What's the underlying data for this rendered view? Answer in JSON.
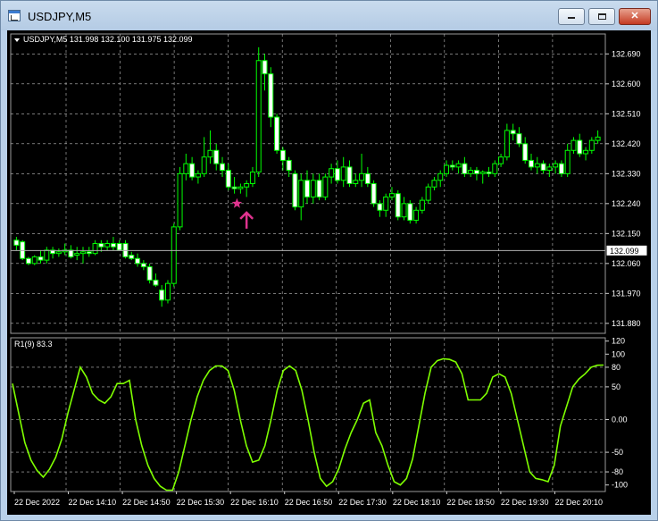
{
  "window": {
    "title": "USDJPY,M5",
    "minimize_icon": "minimize-icon",
    "maximize_icon": "maximize-icon",
    "close_icon": "close-icon",
    "close_label": "✕"
  },
  "price_panel": {
    "header": "USDJPY,M5  131.998 132.100 131.975 132.099",
    "collapse_icon": "triangle-down-icon",
    "current_price": "132.099",
    "annotation_icons": [
      "star-icon",
      "arrow-up-icon"
    ],
    "annotation_color": "#e0338f",
    "candle_color": "#00ff00",
    "grid_color": "#c0c0c0"
  },
  "oscillator_panel": {
    "header": "R1(9) 83.3",
    "line_color": "#7fff00"
  },
  "chart_data": [
    {
      "type": "candlestick",
      "title": "USDJPY,M5",
      "ylim": [
        131.85,
        132.75
      ],
      "y_ticks": [
        "132.690",
        "132.600",
        "132.510",
        "132.420",
        "132.330",
        "132.240",
        "132.150",
        "132.060",
        "131.970",
        "131.880"
      ],
      "x_ticks": [
        "22 Dec 2022",
        "22 Dec 14:10",
        "22 Dec 14:50",
        "22 Dec 15:30",
        "22 Dec 16:10",
        "22 Dec 16:50",
        "22 Dec 17:30",
        "22 Dec 18:10",
        "22 Dec 18:50",
        "22 Dec 19:30",
        "22 Dec 20:10"
      ],
      "last_price": 132.099,
      "ohlc": [
        [
          132.13,
          132.14,
          132.1,
          132.115
        ],
        [
          132.125,
          132.13,
          132.07,
          132.075
        ],
        [
          132.075,
          132.08,
          132.055,
          132.06
        ],
        [
          132.06,
          132.085,
          132.055,
          132.08
        ],
        [
          132.08,
          132.1,
          132.06,
          132.07
        ],
        [
          132.07,
          132.11,
          132.06,
          132.1
        ],
        [
          132.1,
          132.11,
          132.075,
          132.09
        ],
        [
          132.09,
          132.105,
          132.08,
          132.095
        ],
        [
          132.095,
          132.12,
          132.085,
          132.1
        ],
        [
          132.1,
          132.115,
          132.075,
          132.08
        ],
        [
          132.085,
          132.11,
          132.07,
          132.09
        ],
        [
          132.09,
          132.11,
          132.06,
          132.095
        ],
        [
          132.095,
          132.11,
          132.08,
          132.09
        ],
        [
          132.09,
          132.13,
          132.085,
          132.12
        ],
        [
          132.12,
          132.13,
          132.095,
          132.11
        ],
        [
          132.11,
          132.13,
          132.1,
          132.12
        ],
        [
          132.12,
          132.14,
          132.1,
          132.11
        ],
        [
          132.12,
          132.13,
          132.1,
          132.1
        ],
        [
          132.12,
          132.13,
          132.075,
          132.08
        ],
        [
          132.085,
          132.095,
          132.07,
          132.075
        ],
        [
          132.075,
          132.09,
          132.05,
          132.06
        ],
        [
          132.06,
          132.07,
          132.04,
          132.05
        ],
        [
          132.05,
          132.06,
          132.0,
          132.01
        ],
        [
          132.01,
          132.03,
          131.99,
          131.995
        ],
        [
          131.98,
          131.995,
          131.93,
          131.95
        ],
        [
          131.95,
          132.01,
          131.94,
          132.0
        ],
        [
          132.0,
          132.18,
          131.99,
          132.17
        ],
        [
          132.17,
          132.35,
          132.16,
          132.33
        ],
        [
          132.33,
          132.39,
          132.31,
          132.36
        ],
        [
          132.36,
          132.38,
          132.31,
          132.32
        ],
        [
          132.32,
          132.34,
          132.3,
          132.33
        ],
        [
          132.33,
          132.44,
          132.32,
          132.38
        ],
        [
          132.38,
          132.46,
          132.36,
          132.4
        ],
        [
          132.4,
          132.42,
          132.34,
          132.36
        ],
        [
          132.36,
          132.38,
          132.32,
          132.34
        ],
        [
          132.34,
          132.36,
          132.28,
          132.29
        ],
        [
          132.29,
          132.32,
          132.27,
          132.285
        ],
        [
          132.285,
          132.3,
          132.27,
          132.29
        ],
        [
          132.29,
          132.31,
          132.26,
          132.3
        ],
        [
          132.3,
          132.35,
          132.29,
          132.335
        ],
        [
          132.335,
          132.71,
          132.32,
          132.67
        ],
        [
          132.67,
          132.69,
          132.58,
          132.63
        ],
        [
          132.63,
          132.65,
          132.47,
          132.5
        ],
        [
          132.5,
          132.51,
          132.39,
          132.4
        ],
        [
          132.4,
          132.41,
          132.34,
          132.37
        ],
        [
          132.37,
          132.38,
          132.32,
          132.34
        ],
        [
          132.33,
          132.34,
          132.22,
          132.23
        ],
        [
          132.23,
          132.33,
          132.19,
          132.31
        ],
        [
          132.31,
          132.34,
          132.24,
          132.26
        ],
        [
          132.26,
          132.33,
          132.24,
          132.31
        ],
        [
          132.31,
          132.33,
          132.25,
          132.26
        ],
        [
          132.26,
          132.33,
          132.25,
          132.32
        ],
        [
          132.32,
          132.36,
          132.3,
          132.345
        ],
        [
          132.345,
          132.37,
          132.3,
          132.31
        ],
        [
          132.31,
          132.38,
          132.29,
          132.35
        ],
        [
          132.35,
          132.37,
          132.29,
          132.3
        ],
        [
          132.3,
          132.33,
          132.29,
          132.31
        ],
        [
          132.31,
          132.39,
          132.29,
          132.33
        ],
        [
          132.33,
          132.35,
          132.29,
          132.3
        ],
        [
          132.3,
          132.31,
          132.23,
          132.24
        ],
        [
          132.24,
          132.25,
          132.2,
          132.22
        ],
        [
          132.22,
          132.27,
          132.2,
          132.26
        ],
        [
          132.26,
          132.29,
          132.25,
          132.27
        ],
        [
          132.27,
          132.28,
          132.19,
          132.2
        ],
        [
          132.2,
          132.26,
          132.19,
          132.24
        ],
        [
          132.24,
          132.25,
          132.18,
          132.19
        ],
        [
          132.19,
          132.23,
          132.18,
          132.22
        ],
        [
          132.22,
          132.26,
          132.21,
          132.25
        ],
        [
          132.25,
          132.3,
          132.24,
          132.29
        ],
        [
          132.29,
          132.32,
          132.28,
          132.31
        ],
        [
          132.31,
          132.34,
          132.29,
          132.33
        ],
        [
          132.33,
          132.37,
          132.32,
          132.355
        ],
        [
          132.355,
          132.37,
          132.34,
          132.35
        ],
        [
          132.35,
          132.37,
          132.33,
          132.36
        ],
        [
          132.36,
          132.38,
          132.32,
          132.33
        ],
        [
          132.33,
          132.35,
          132.32,
          132.34
        ],
        [
          132.34,
          132.35,
          132.31,
          132.33
        ],
        [
          132.33,
          132.34,
          132.3,
          132.335
        ],
        [
          132.335,
          132.35,
          132.32,
          132.33
        ],
        [
          132.33,
          132.37,
          132.32,
          132.36
        ],
        [
          132.36,
          132.39,
          132.35,
          132.38
        ],
        [
          132.38,
          132.48,
          132.37,
          132.46
        ],
        [
          132.46,
          132.48,
          132.43,
          132.45
        ],
        [
          132.45,
          132.47,
          132.41,
          132.42
        ],
        [
          132.42,
          132.44,
          132.36,
          132.37
        ],
        [
          132.37,
          132.39,
          132.34,
          132.35
        ],
        [
          132.35,
          132.38,
          132.33,
          132.36
        ],
        [
          132.36,
          132.37,
          132.33,
          132.34
        ],
        [
          132.34,
          132.36,
          132.32,
          132.35
        ],
        [
          132.35,
          132.37,
          132.33,
          132.36
        ],
        [
          132.36,
          132.37,
          132.32,
          132.33
        ],
        [
          132.33,
          132.42,
          132.32,
          132.4
        ],
        [
          132.4,
          132.44,
          132.39,
          132.43
        ],
        [
          132.43,
          132.45,
          132.38,
          132.39
        ],
        [
          132.39,
          132.41,
          132.37,
          132.4
        ],
        [
          132.4,
          132.44,
          132.39,
          132.43
        ],
        [
          132.43,
          132.46,
          132.42,
          132.44
        ]
      ]
    },
    {
      "type": "line",
      "title": "R1(9) 83.3",
      "ylim": [
        -110,
        125
      ],
      "y_ticks": [
        "120",
        "100",
        "80",
        "50",
        "0.00",
        "-50",
        "-80",
        "-100"
      ],
      "last_value": 83.3,
      "series": [
        {
          "values": [
            55,
            10,
            -35,
            -62,
            -78,
            -88,
            -76,
            -58,
            -30,
            10,
            45,
            80,
            65,
            40,
            30,
            25,
            35,
            55,
            55,
            60,
            0,
            -40,
            -70,
            -90,
            -102,
            -108,
            -108,
            -80,
            -40,
            0,
            35,
            60,
            75,
            82,
            82,
            75,
            45,
            0,
            -40,
            -65,
            -62,
            -40,
            0,
            45,
            75,
            82,
            75,
            45,
            0,
            -50,
            -90,
            -102,
            -95,
            -75,
            -45,
            -20,
            0,
            25,
            30,
            -20,
            -40,
            -70,
            -95,
            -100,
            -90,
            -60,
            -10,
            40,
            80,
            90,
            93,
            92,
            88,
            70,
            30,
            30,
            30,
            40,
            65,
            70,
            65,
            40,
            0,
            -40,
            -80,
            -90,
            -92,
            -95,
            -70,
            -10,
            20,
            50,
            62,
            70,
            80,
            83,
            83.3
          ]
        }
      ]
    }
  ]
}
